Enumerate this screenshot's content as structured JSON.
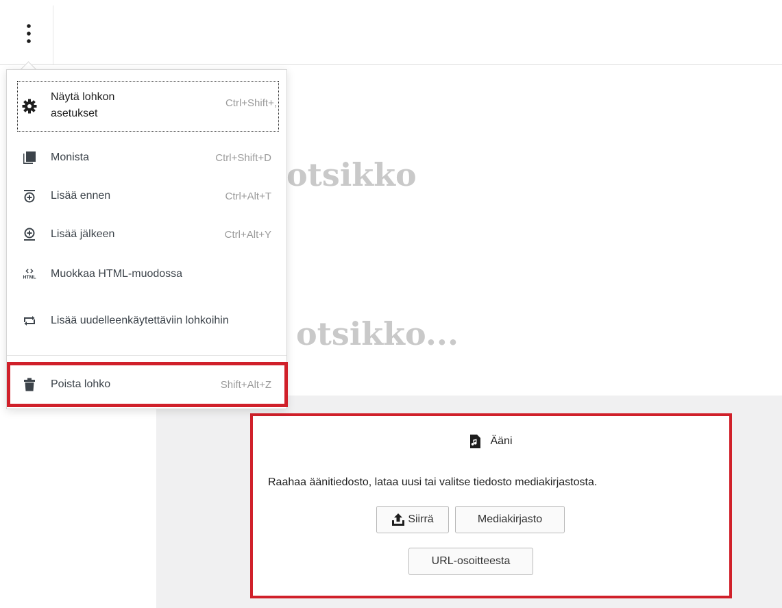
{
  "toolbar": {
    "more_icon": "more-vertical-icon"
  },
  "background_headings": [
    "otsikko",
    "otsikko..."
  ],
  "menu": {
    "items": [
      {
        "label": "Näytä lohkon asetukset",
        "shortcut": "Ctrl+Shift+,",
        "icon": "gear-icon"
      },
      {
        "label": "Monista",
        "shortcut": "Ctrl+Shift+D",
        "icon": "duplicate-icon"
      },
      {
        "label": "Lisää ennen",
        "shortcut": "Ctrl+Alt+T",
        "icon": "insert-before-icon"
      },
      {
        "label": "Lisää jälkeen",
        "shortcut": "Ctrl+Alt+Y",
        "icon": "insert-after-icon"
      },
      {
        "label": "Muokkaa HTML-muodossa",
        "shortcut": "",
        "icon": "html-icon"
      },
      {
        "label": "Lisää uudelleenkäytettäviin lohkoihin",
        "shortcut": "",
        "icon": "reusable-icon"
      },
      {
        "label": "Poista lohko",
        "shortcut": "Shift+Alt+Z",
        "icon": "trash-icon"
      }
    ]
  },
  "audio_block": {
    "title": "Ääni",
    "icon": "audio-file-icon",
    "instructions": "Raahaa äänitiedosto, lataa uusi tai valitse tiedosto mediakirjastosta.",
    "buttons": {
      "upload": "Siirrä",
      "media_library": "Mediakirjasto",
      "from_url": "URL-osoitteesta"
    }
  },
  "colors": {
    "highlight": "#d0202a",
    "editor_background": "#f0f0f1"
  }
}
